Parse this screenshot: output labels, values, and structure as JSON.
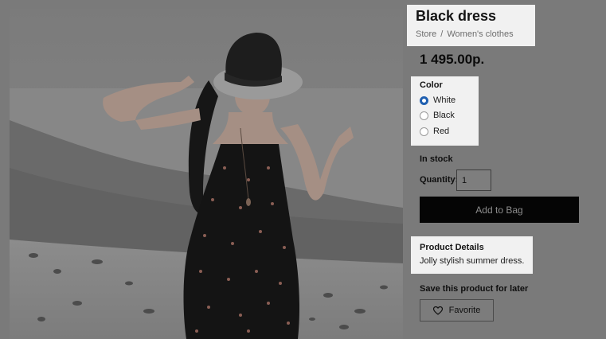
{
  "product": {
    "title": "Black dress",
    "price": "1 495.00p.",
    "image_alt": "Woman in a black floral dress and wide-brimmed hat on a beach"
  },
  "breadcrumb": {
    "items": [
      "Store",
      "Women's clothes"
    ],
    "separator": "/"
  },
  "color": {
    "label": "Color",
    "options": [
      "White",
      "Black",
      "Red"
    ],
    "selected": "White"
  },
  "stock": {
    "status": "In stock"
  },
  "quantity": {
    "label": "Quantity:",
    "value": "1"
  },
  "actions": {
    "add_to_bag": "Add to Bag",
    "save_label": "Save this product for later",
    "favorite": "Favorite"
  },
  "details": {
    "title": "Product Details",
    "text": "Jolly stylish summer dress."
  },
  "icons": {
    "favorite": "heart-icon",
    "radio_checked": "radio-checked-icon"
  },
  "colors": {
    "accent": "#1f5fb0",
    "button": "#050505",
    "highlight": "#f1f1f1",
    "overlay": "#7a7a7a"
  }
}
